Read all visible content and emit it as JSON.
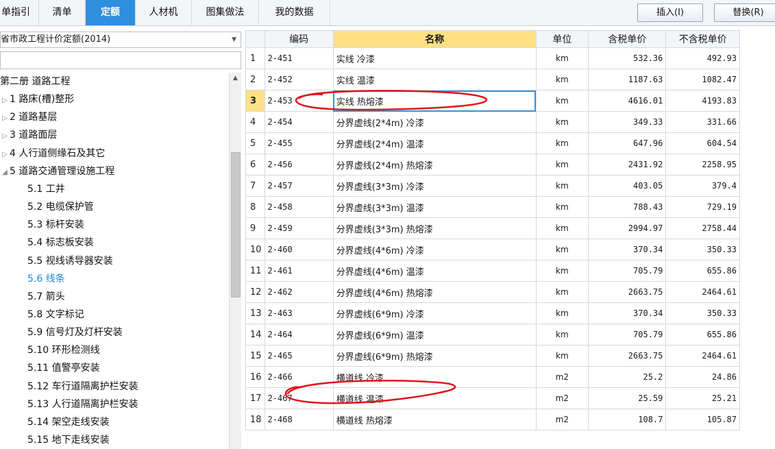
{
  "tabs": [
    {
      "label": "单指引",
      "active": false
    },
    {
      "label": "清单",
      "active": false
    },
    {
      "label": "定额",
      "active": true
    },
    {
      "label": "人材机",
      "active": false
    },
    {
      "label": "图集做法",
      "active": false
    },
    {
      "label": "我的数据",
      "active": false
    }
  ],
  "toolbar": {
    "insert_label": "插入(I)",
    "replace_label": "替换(R)"
  },
  "library": {
    "selected": "省市政工程计价定额(2014)",
    "search_value": ""
  },
  "tree": [
    {
      "label": "第二册 道路工程",
      "level": 0,
      "chevron": "",
      "selected": false
    },
    {
      "label": "1 路床(槽)整形",
      "level": 1,
      "chevron": "right",
      "selected": false
    },
    {
      "label": "2 道路基层",
      "level": 1,
      "chevron": "right",
      "selected": false
    },
    {
      "label": "3 道路面层",
      "level": 1,
      "chevron": "right",
      "selected": false
    },
    {
      "label": "4 人行道侧缘石及其它",
      "level": 1,
      "chevron": "right",
      "selected": false
    },
    {
      "label": "5 道路交通管理设施工程",
      "level": 1,
      "chevron": "down",
      "selected": false
    },
    {
      "label": "5.1 工井",
      "level": 2,
      "chevron": "",
      "selected": false
    },
    {
      "label": "5.2 电缆保护管",
      "level": 2,
      "chevron": "",
      "selected": false
    },
    {
      "label": "5.3 标杆安装",
      "level": 2,
      "chevron": "",
      "selected": false
    },
    {
      "label": "5.4 标志板安装",
      "level": 2,
      "chevron": "",
      "selected": false
    },
    {
      "label": "5.5 视线诱导器安装",
      "level": 2,
      "chevron": "",
      "selected": false
    },
    {
      "label": "5.6 线条",
      "level": 2,
      "chevron": "",
      "selected": true
    },
    {
      "label": "5.7 箭头",
      "level": 2,
      "chevron": "",
      "selected": false
    },
    {
      "label": "5.8 文字标记",
      "level": 2,
      "chevron": "",
      "selected": false
    },
    {
      "label": "5.9 信号灯及灯杆安装",
      "level": 2,
      "chevron": "",
      "selected": false
    },
    {
      "label": "5.10 环形检测线",
      "level": 2,
      "chevron": "",
      "selected": false
    },
    {
      "label": "5.11 值警亭安装",
      "level": 2,
      "chevron": "",
      "selected": false
    },
    {
      "label": "5.12 车行道隔离护栏安装",
      "level": 2,
      "chevron": "",
      "selected": false
    },
    {
      "label": "5.13 人行道隔离护栏安装",
      "level": 2,
      "chevron": "",
      "selected": false
    },
    {
      "label": "5.14 架空走线安装",
      "level": 2,
      "chevron": "",
      "selected": false
    },
    {
      "label": "5.15 地下走线安装",
      "level": 2,
      "chevron": "",
      "selected": false
    }
  ],
  "grid": {
    "columns": [
      "",
      "编码",
      "名称",
      "单位",
      "含税单价",
      "不含税单价"
    ],
    "current_row": 3,
    "rows": [
      {
        "n": "1",
        "code": "2-451",
        "name": "实线 冷漆",
        "unit": "km",
        "tax": "532.36",
        "notax": "492.93"
      },
      {
        "n": "2",
        "code": "2-452",
        "name": "实线 温漆",
        "unit": "km",
        "tax": "1187.63",
        "notax": "1082.47"
      },
      {
        "n": "3",
        "code": "2-453",
        "name": "实线 热熔漆",
        "unit": "km",
        "tax": "4616.01",
        "notax": "4193.83"
      },
      {
        "n": "4",
        "code": "2-454",
        "name": "分界虚线(2*4m) 冷漆",
        "unit": "km",
        "tax": "349.33",
        "notax": "331.66"
      },
      {
        "n": "5",
        "code": "2-455",
        "name": "分界虚线(2*4m) 温漆",
        "unit": "km",
        "tax": "647.96",
        "notax": "604.54"
      },
      {
        "n": "6",
        "code": "2-456",
        "name": "分界虚线(2*4m) 热熔漆",
        "unit": "km",
        "tax": "2431.92",
        "notax": "2258.95"
      },
      {
        "n": "7",
        "code": "2-457",
        "name": "分界虚线(3*3m) 冷漆",
        "unit": "km",
        "tax": "403.05",
        "notax": "379.4"
      },
      {
        "n": "8",
        "code": "2-458",
        "name": "分界虚线(3*3m) 温漆",
        "unit": "km",
        "tax": "788.43",
        "notax": "729.19"
      },
      {
        "n": "9",
        "code": "2-459",
        "name": "分界虚线(3*3m) 热熔漆",
        "unit": "km",
        "tax": "2994.97",
        "notax": "2758.44"
      },
      {
        "n": "10",
        "code": "2-460",
        "name": "分界虚线(4*6m) 冷漆",
        "unit": "km",
        "tax": "370.34",
        "notax": "350.33"
      },
      {
        "n": "11",
        "code": "2-461",
        "name": "分界虚线(4*6m) 温漆",
        "unit": "km",
        "tax": "705.79",
        "notax": "655.86"
      },
      {
        "n": "12",
        "code": "2-462",
        "name": "分界虚线(4*6m) 热熔漆",
        "unit": "km",
        "tax": "2663.75",
        "notax": "2464.61"
      },
      {
        "n": "13",
        "code": "2-463",
        "name": "分界虚线(6*9m) 冷漆",
        "unit": "km",
        "tax": "370.34",
        "notax": "350.33"
      },
      {
        "n": "14",
        "code": "2-464",
        "name": "分界虚线(6*9m) 温漆",
        "unit": "km",
        "tax": "705.79",
        "notax": "655.86"
      },
      {
        "n": "15",
        "code": "2-465",
        "name": "分界虚线(6*9m) 热熔漆",
        "unit": "km",
        "tax": "2663.75",
        "notax": "2464.61"
      },
      {
        "n": "16",
        "code": "2-466",
        "name": "横道线 冷漆",
        "unit": "m2",
        "tax": "25.2",
        "notax": "24.86"
      },
      {
        "n": "17",
        "code": "2-467",
        "name": "横道线 温漆",
        "unit": "m2",
        "tax": "25.59",
        "notax": "25.21"
      },
      {
        "n": "18",
        "code": "2-468",
        "name": "横道线 热熔漆",
        "unit": "m2",
        "tax": "108.7",
        "notax": "105.87"
      }
    ]
  },
  "colors": {
    "accent": "#2e8fdf",
    "header_highlight": "#ffe184",
    "selected_tree": "#1e88e5",
    "annotation": "#e0151b"
  }
}
